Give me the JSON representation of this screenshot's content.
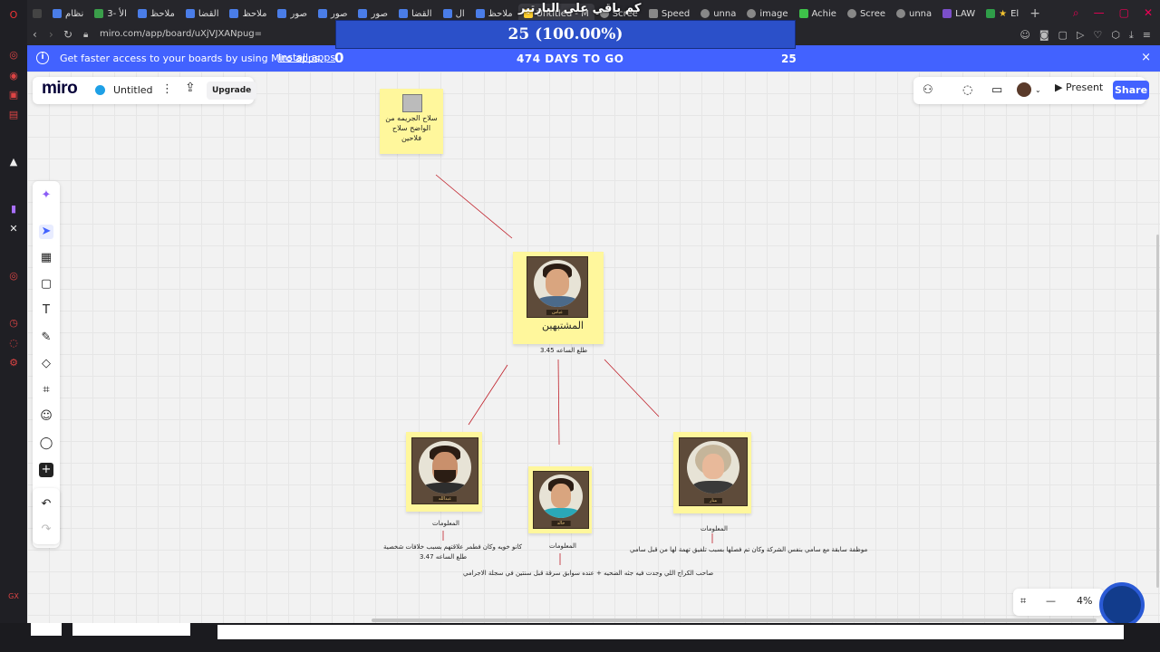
{
  "browser": {
    "tabs": [
      {
        "label": "نظام"
      },
      {
        "label": "3- الأ"
      },
      {
        "label": "ملاحظ"
      },
      {
        "label": "القضا"
      },
      {
        "label": "ملاحظ"
      },
      {
        "label": "صور"
      },
      {
        "label": "صور"
      },
      {
        "label": "صور"
      },
      {
        "label": "القضا"
      },
      {
        "label": "ال"
      },
      {
        "label": "ملاحظ"
      },
      {
        "label": "Untitled - M"
      },
      {
        "label": "Scree"
      },
      {
        "label": "Speed"
      },
      {
        "label": "unna"
      },
      {
        "label": "image"
      },
      {
        "label": "Achie"
      },
      {
        "label": "Scree"
      },
      {
        "label": "unna"
      },
      {
        "label": "LAW"
      },
      {
        "label": "El"
      }
    ],
    "url": "miro.com/app/board/uXjVJXANpug="
  },
  "overlay": {
    "counter": "25 (100.00%)",
    "arabic_caption": "كم باقي على البارتير"
  },
  "banner": {
    "message": "Get faster access to your boards by using Miro apps.",
    "install_label": "Install apps",
    "left_number": "0",
    "days_text": "474 DAYS TO GO",
    "right_number": "25",
    "close_icon": "×"
  },
  "miro": {
    "logo": "miro",
    "board_title": "Untitled",
    "upgrade_label": "Upgrade",
    "present_label": "Present",
    "share_label": "Share",
    "zoom_level": "4%",
    "accent": "#4262ff"
  },
  "board": {
    "top_note": "سلاح الجريمه من الواضح سلاح فلاحين",
    "center_title": "المشتبهين",
    "center_name": "عباس",
    "center_time": "طلع الساعه 3.45",
    "left_name": "عبدالله",
    "left_info_label": "المعلومات",
    "left_info_text": "كانو خويه وكان فطمر علاقتهم بسبب خلافات شخصية",
    "left_info_time": "طلع الساعه 3.47",
    "middle_name": "خالد",
    "middle_info_label": "المعلومات",
    "middle_info_text": "صاحب الكراج اللي وجدت فيه جثه الضحيه + عنده سوابق سرقة قبل سنتين في سجلة الاجرامي",
    "right_name": "منار",
    "right_info_label": "المعلومات",
    "right_info_text": "موظفة سابقة مع سامي بنفس الشركة وكان تم فصلها بسبب تلفيق تهمة لها من قبل سامي"
  }
}
